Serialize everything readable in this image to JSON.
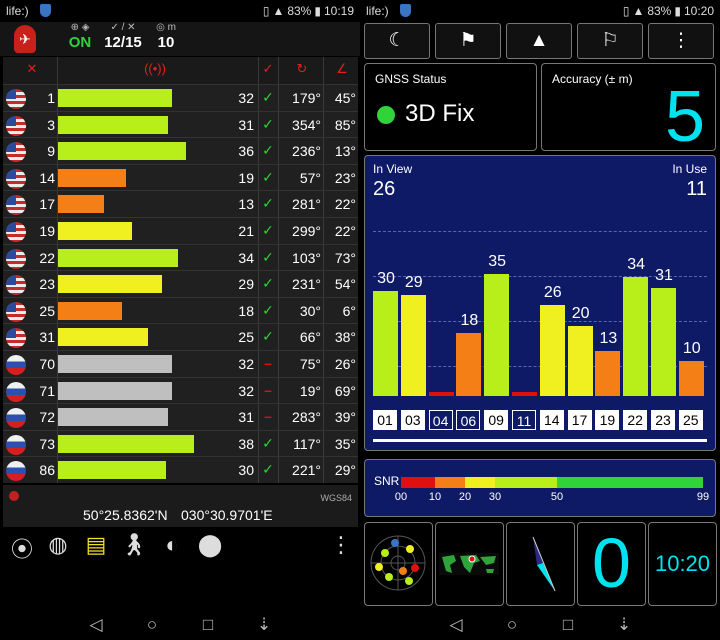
{
  "left": {
    "status": {
      "carrier": "life:)",
      "battery": "83%",
      "time": "10:19"
    },
    "header": {
      "gps_state": "ON",
      "sats_used_visible": "12/15",
      "accuracy": "10",
      "accuracy_unit": "m"
    },
    "rows": [
      {
        "prn": "1",
        "flag": "us",
        "snr": "32",
        "used": "✓",
        "az": "179°",
        "el": "45°",
        "snr_frac": 0.57,
        "color": "#b8ee1a"
      },
      {
        "prn": "3",
        "flag": "us",
        "snr": "31",
        "used": "✓",
        "az": "354°",
        "el": "85°",
        "snr_frac": 0.55,
        "color": "#b8ee1a"
      },
      {
        "prn": "9",
        "flag": "us",
        "snr": "36",
        "used": "✓",
        "az": "236°",
        "el": "13°",
        "snr_frac": 0.64,
        "color": "#b8ee1a"
      },
      {
        "prn": "14",
        "flag": "us",
        "snr": "19",
        "used": "✓",
        "az": "57°",
        "el": "23°",
        "snr_frac": 0.34,
        "color": "#f57f17"
      },
      {
        "prn": "17",
        "flag": "us",
        "snr": "13",
        "used": "✓",
        "az": "281°",
        "el": "22°",
        "snr_frac": 0.23,
        "color": "#f57f17"
      },
      {
        "prn": "19",
        "flag": "us",
        "snr": "21",
        "used": "✓",
        "az": "299°",
        "el": "22°",
        "snr_frac": 0.37,
        "color": "#f0f020"
      },
      {
        "prn": "22",
        "flag": "us",
        "snr": "34",
        "used": "✓",
        "az": "103°",
        "el": "73°",
        "snr_frac": 0.6,
        "color": "#b8ee1a"
      },
      {
        "prn": "23",
        "flag": "us",
        "snr": "29",
        "used": "✓",
        "az": "231°",
        "el": "54°",
        "snr_frac": 0.52,
        "color": "#f0f020"
      },
      {
        "prn": "25",
        "flag": "us",
        "snr": "18",
        "used": "✓",
        "az": "30°",
        "el": "6°",
        "snr_frac": 0.32,
        "color": "#f57f17"
      },
      {
        "prn": "31",
        "flag": "us",
        "snr": "25",
        "used": "✓",
        "az": "66°",
        "el": "38°",
        "snr_frac": 0.45,
        "color": "#f0f020"
      },
      {
        "prn": "70",
        "flag": "ru",
        "snr": "32",
        "used": "–",
        "az": "75°",
        "el": "26°",
        "snr_frac": 0.57,
        "color": "#bfbfbf"
      },
      {
        "prn": "71",
        "flag": "ru",
        "snr": "32",
        "used": "–",
        "az": "19°",
        "el": "69°",
        "snr_frac": 0.57,
        "color": "#bfbfbf"
      },
      {
        "prn": "72",
        "flag": "ru",
        "snr": "31",
        "used": "–",
        "az": "283°",
        "el": "39°",
        "snr_frac": 0.55,
        "color": "#bfbfbf"
      },
      {
        "prn": "73",
        "flag": "ru",
        "snr": "38",
        "used": "✓",
        "az": "117°",
        "el": "35°",
        "snr_frac": 0.68,
        "color": "#b8ee1a"
      },
      {
        "prn": "86",
        "flag": "ru",
        "snr": "30",
        "used": "✓",
        "az": "221°",
        "el": "29°",
        "snr_frac": 0.54,
        "color": "#b8ee1a"
      }
    ],
    "coords": {
      "lat": "50°25.8362'N",
      "lon": "030°30.9701'E",
      "datum": "WGS84"
    }
  },
  "right": {
    "status": {
      "carrier": "life:)",
      "battery": "83%",
      "time": "10:20"
    },
    "gnss": {
      "label": "GNSS Status",
      "fix": "3D Fix",
      "fix_color": "#2fd33a"
    },
    "accuracy": {
      "label": "Accuracy (± m)",
      "value": "5"
    },
    "sky": {
      "in_view_label": "In View",
      "in_view": "26",
      "in_use_label": "In Use",
      "in_use": "11",
      "bars": [
        {
          "prn": "01",
          "value": "30",
          "used": true,
          "height": 30,
          "color": "#b8ee1a"
        },
        {
          "prn": "03",
          "value": "29",
          "used": true,
          "height": 29,
          "color": "#f0f020"
        },
        {
          "prn": "04",
          "value": "",
          "used": false,
          "height": 1,
          "color": "#e01010"
        },
        {
          "prn": "06",
          "value": "18",
          "used": false,
          "height": 18,
          "color": "#f57f17"
        },
        {
          "prn": "09",
          "value": "35",
          "used": true,
          "height": 35,
          "color": "#b8ee1a"
        },
        {
          "prn": "11",
          "value": "",
          "used": false,
          "height": 1,
          "color": "#e01010"
        },
        {
          "prn": "14",
          "value": "26",
          "used": true,
          "height": 26,
          "color": "#f0f020"
        },
        {
          "prn": "17",
          "value": "20",
          "used": true,
          "height": 20,
          "color": "#f0f020"
        },
        {
          "prn": "19",
          "value": "13",
          "used": true,
          "height": 13,
          "color": "#f57f17"
        },
        {
          "prn": "22",
          "value": "34",
          "used": true,
          "height": 34,
          "color": "#b8ee1a"
        },
        {
          "prn": "23",
          "value": "31",
          "used": true,
          "height": 31,
          "color": "#b8ee1a"
        },
        {
          "prn": "25",
          "value": "10",
          "used": true,
          "height": 10,
          "color": "#f57f17"
        }
      ]
    },
    "snr": {
      "label": "SNR",
      "scale": [
        {
          "tick": "00",
          "color": "#e01010"
        },
        {
          "tick": "10",
          "color": "#f57f17"
        },
        {
          "tick": "20",
          "color": "#f0f020"
        },
        {
          "tick": "30",
          "color": "#b8ee1a"
        },
        {
          "tick": "50",
          "color": "#2fd33a"
        },
        {
          "tick": "99",
          "color": ""
        }
      ]
    },
    "tiles": {
      "number": "0",
      "clock": "10:20"
    }
  }
}
